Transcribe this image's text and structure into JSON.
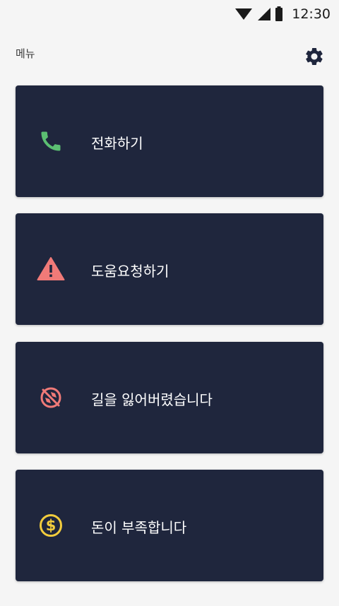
{
  "status_bar": {
    "time": "12:30",
    "icons": [
      "wifi-icon",
      "cell-signal-icon",
      "battery-icon"
    ]
  },
  "header": {
    "title": "메뉴",
    "settings_icon": "gear-icon"
  },
  "cards": [
    {
      "label": "전화하기",
      "icon": "phone-icon",
      "icon_color": "#5bbf72"
    },
    {
      "label": "도움요청하기",
      "icon": "warning-icon",
      "icon_color": "#f07a78"
    },
    {
      "label": "길을 잃어버렸습니다",
      "icon": "explore-off-icon",
      "icon_color": "#f07a78"
    },
    {
      "label": "돈이 부족합니다",
      "icon": "dollar-coin-icon",
      "icon_color": "#f2cc3d"
    }
  ],
  "colors": {
    "background": "#f5f5f5",
    "card": "#1f263d",
    "text_light": "#ffffff",
    "text_dark": "#3a3a3a"
  }
}
